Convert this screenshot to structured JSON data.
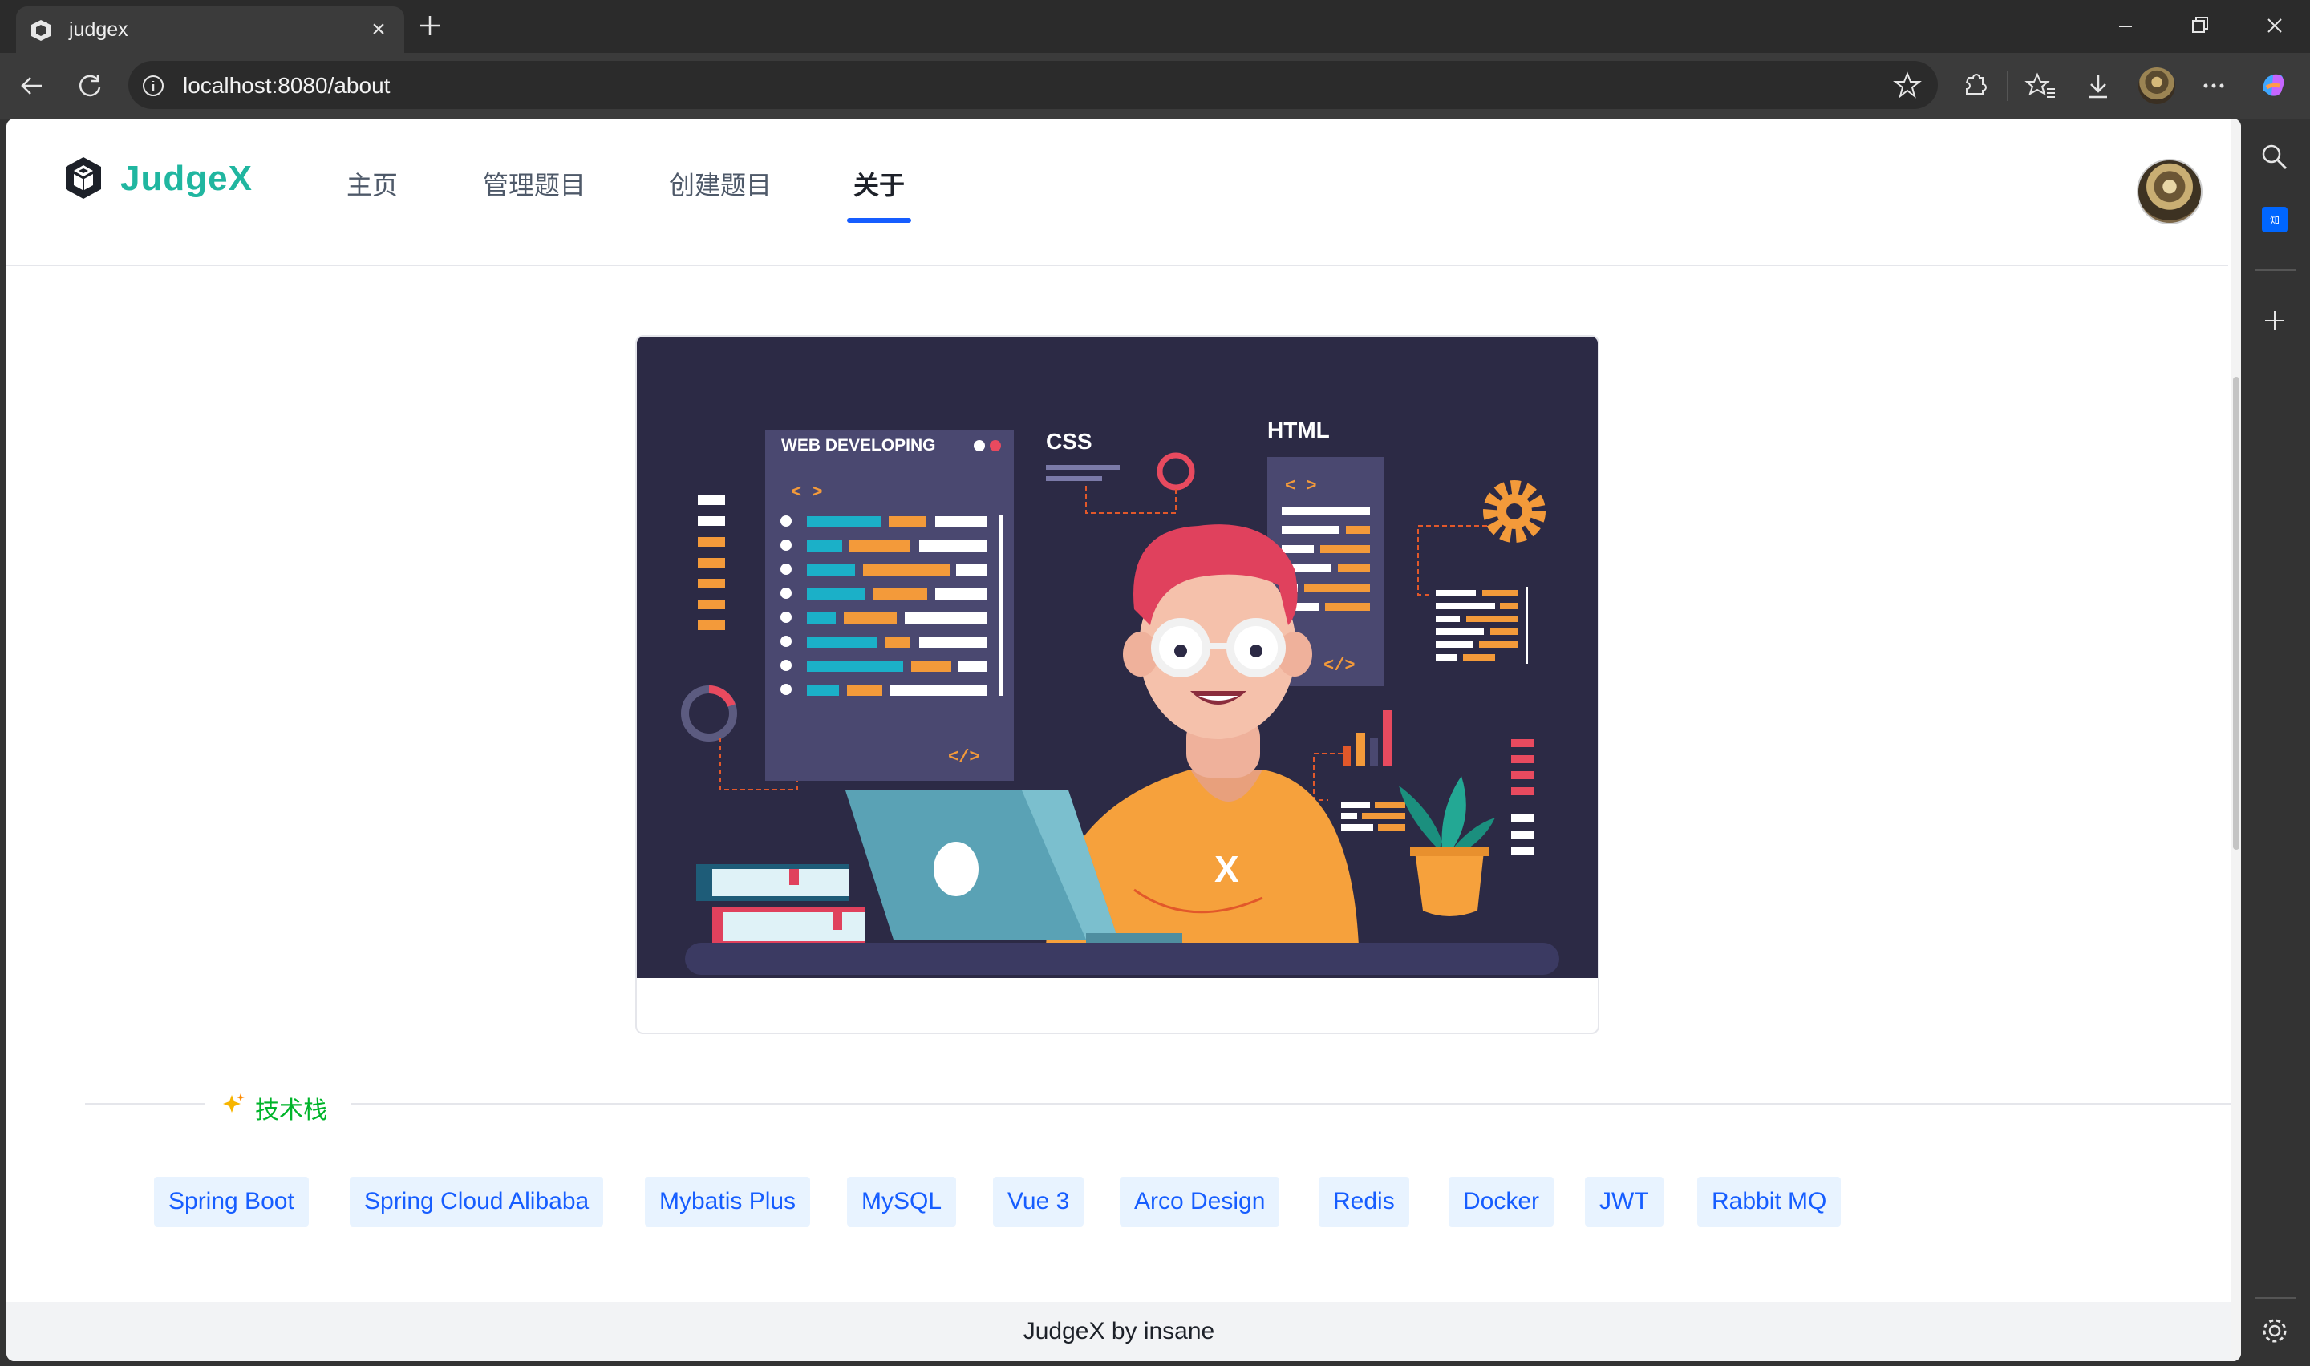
{
  "browser": {
    "tab_title": "judgex",
    "url": "localhost:8080/about"
  },
  "nav": {
    "brand": "JudgeX",
    "items": [
      {
        "label": "主页"
      },
      {
        "label": "管理题目"
      },
      {
        "label": "创建题目"
      },
      {
        "label": "关于"
      }
    ],
    "active_item": "关于"
  },
  "illustration": {
    "panel_title": "WEB DEVELOPING",
    "css_label": "CSS",
    "html_label": "HTML",
    "tag_open": "< >",
    "tag_close": "</>",
    "shirt_letter": "X"
  },
  "tech_stack": {
    "title": "技术栈",
    "tags": [
      "Spring Boot",
      "Spring Cloud Alibaba",
      "Mybatis Plus",
      "MySQL",
      "Vue 3",
      "Arco Design",
      "Redis",
      "Docker",
      "JWT",
      "Rabbit MQ"
    ]
  },
  "footer": {
    "text": "JudgeX by insane"
  },
  "colors": {
    "brand": "#20b6a0",
    "primary": "#165dff",
    "tag_bg": "#e8f3ff",
    "success": "#00b42a",
    "illustration_bg": "#2c2a45"
  }
}
